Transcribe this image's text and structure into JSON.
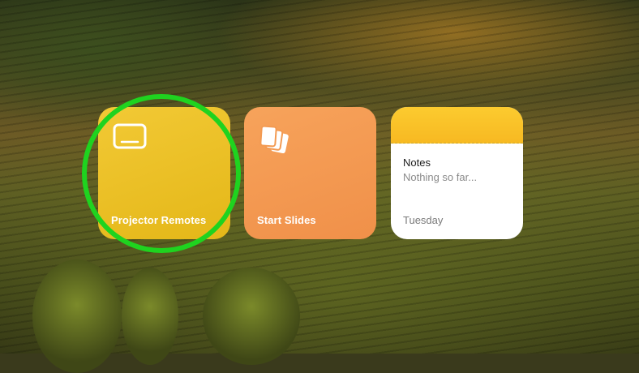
{
  "widgets": {
    "projector": {
      "label": "Projector Remotes",
      "icon": "display-icon",
      "color": "#f2c935"
    },
    "slides": {
      "label": "Start Slides",
      "icon": "stacked-pages-icon",
      "color": "#f7a35b"
    },
    "notes": {
      "title": "Notes",
      "body": "Nothing so far...",
      "date": "Tuesday",
      "accent": "#fccb2f"
    }
  },
  "highlight": {
    "color": "#1fd31f"
  }
}
